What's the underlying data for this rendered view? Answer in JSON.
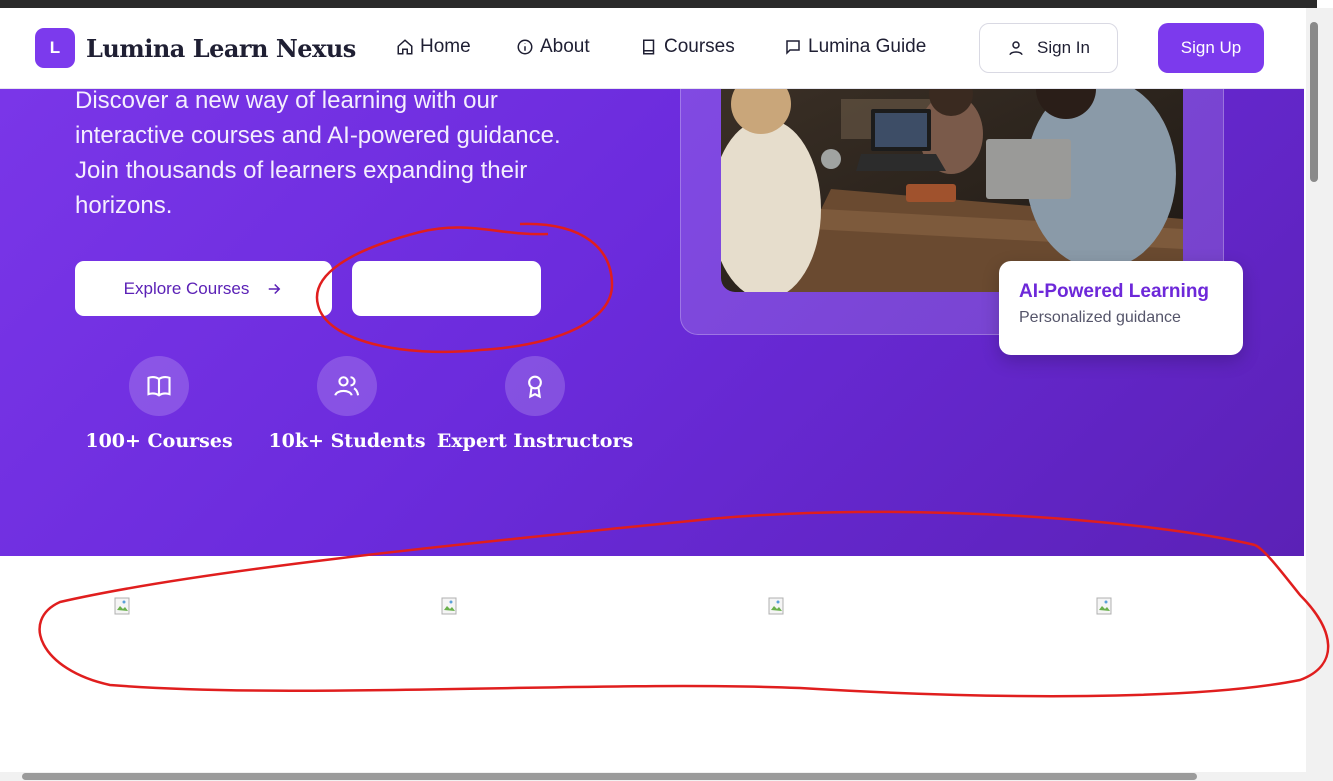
{
  "brand": {
    "initial": "L",
    "name": "Lumina Learn Nexus"
  },
  "nav": {
    "home": "Home",
    "about": "About",
    "courses": "Courses",
    "guide": "Lumina Guide",
    "sign_in": "Sign In",
    "sign_up": "Sign Up"
  },
  "hero": {
    "description": "Discover a new way of learning with our interactive courses and AI-powered guidance. Join thousands of learners expanding their horizons.",
    "explore_label": "Explore Courses",
    "stats": [
      {
        "icon": "book-open-icon",
        "label": "100+ Courses"
      },
      {
        "icon": "users-icon",
        "label": "10k+ Students"
      },
      {
        "icon": "award-icon",
        "label": "Expert Instructors"
      }
    ],
    "ai_card": {
      "title": "AI-Powered Learning",
      "subtitle": "Personalized guidance"
    }
  },
  "colors": {
    "brand": "#7c3aed",
    "hero_start": "#7a36e8",
    "hero_end": "#5b21b6",
    "annotation": "#e01e1e"
  }
}
